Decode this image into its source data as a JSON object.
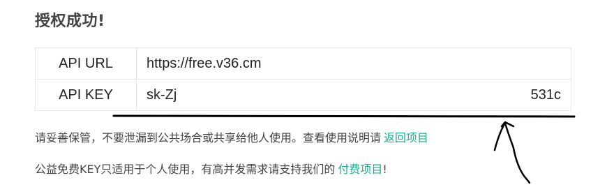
{
  "title": "授权成功!",
  "table": {
    "rows": [
      {
        "label": "API URL",
        "value": "https://free.v36.cm",
        "value_suffix": ""
      },
      {
        "label": "API KEY",
        "value": "sk-Zj",
        "value_suffix": "531c"
      }
    ]
  },
  "notes": {
    "line1_text": "请妥善保管，不要泄漏到公共场合或共享给他人使用。查看使用说明请",
    "line1_link": "返回项目",
    "line2_text": "公益免费KEY只适用于个人使用，有高并发需求请支持我们的",
    "line2_link": "付费项目",
    "line2_end": "!"
  },
  "colors": {
    "link": "#1aaf8e",
    "annotation_ink": "#000000"
  },
  "annotation": {
    "underline": "hand-drawn-underline",
    "arrow": "hand-drawn-arrow-icon"
  }
}
